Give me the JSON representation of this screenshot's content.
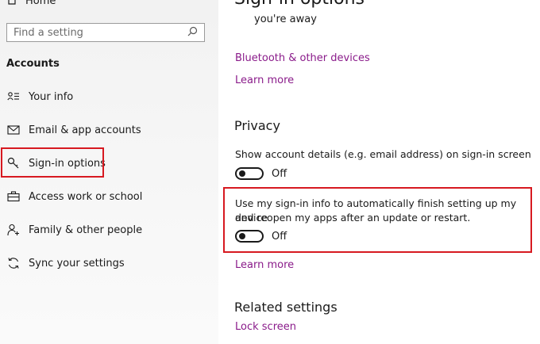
{
  "sidebar": {
    "home_label": "Home",
    "search": {
      "placeholder": "Find a setting"
    },
    "section_title": "Accounts",
    "items": [
      {
        "label": "Your info",
        "icon": "person-list-icon"
      },
      {
        "label": "Email & app accounts",
        "icon": "mail-icon"
      },
      {
        "label": "Sign-in options",
        "icon": "key-icon",
        "selected": true
      },
      {
        "label": "Access work or school",
        "icon": "briefcase-icon"
      },
      {
        "label": "Family & other people",
        "icon": "person-add-icon"
      },
      {
        "label": "Sync your settings",
        "icon": "sync-icon"
      }
    ]
  },
  "main": {
    "title": "Sign-in options",
    "away_text": "you're away",
    "bluetooth_link": "Bluetooth & other devices",
    "learn_more_1": "Learn more",
    "privacy": {
      "heading": "Privacy",
      "show_details": {
        "text": "Show account details (e.g. email address) on sign-in screen",
        "state": "Off"
      },
      "use_signin": {
        "line1": "Use my sign-in info to automatically finish setting up my device",
        "line2": "and reopen my apps after an update or restart.",
        "state": "Off"
      },
      "learn_more": "Learn more"
    },
    "related": {
      "heading": "Related settings",
      "lock_screen": "Lock screen"
    }
  },
  "colors": {
    "link": "#8a1b8a",
    "highlight": "#d71920"
  }
}
